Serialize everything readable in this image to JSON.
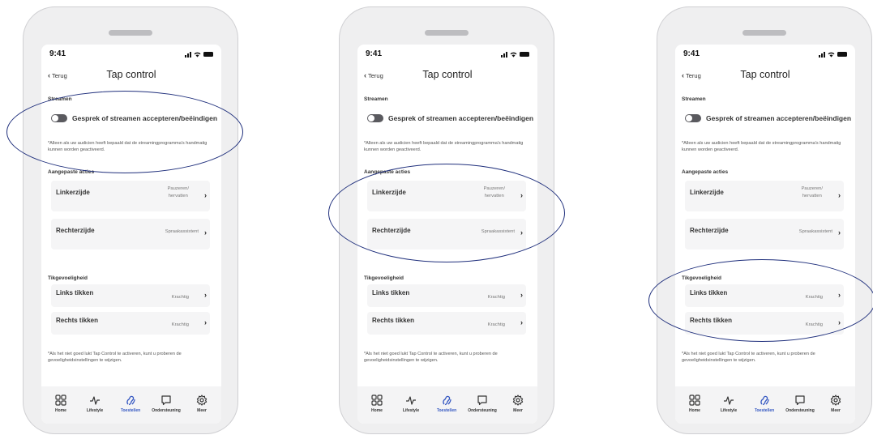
{
  "status": {
    "time": "9:41"
  },
  "nav": {
    "back_label": "Terug",
    "title": "Tap control"
  },
  "streaming": {
    "header": "Streamen",
    "toggle_label": "Gesprek of streamen accepteren/beëindigen",
    "note": "*Alleen als uw audicien heeft bepaald dat de streamingprogramma's handmatig kunnen worden geactiveerd."
  },
  "custom_actions": {
    "header": "Aangepaste acties",
    "left": {
      "label": "Linkerzijde",
      "value_line1": "Pauzeren/",
      "value_line2": "hervatten"
    },
    "right": {
      "label": "Rechterzijde",
      "value": "Spraakassistent"
    }
  },
  "sensitivity": {
    "header": "Tikgevoeligheid",
    "left": {
      "label": "Links tikken",
      "value": "Krachtig"
    },
    "right": {
      "label": "Rechts tikken",
      "value": "Krachtig"
    },
    "note": "*Als het niet goed lukt Tap Control te activeren, kunt u proberen de gevoeligheidsinstellingen te wijzigen."
  },
  "tabs": [
    {
      "label": "Home",
      "icon": "grid-icon"
    },
    {
      "label": "Lifestyle",
      "icon": "pulse-icon"
    },
    {
      "label": "Toestellen",
      "icon": "hearing-aid-icon"
    },
    {
      "label": "Ondersteuning",
      "icon": "chat-icon"
    },
    {
      "label": "Meer",
      "icon": "gear-icon"
    }
  ],
  "colors": {
    "accent": "#3558c2",
    "highlight_oval": "#1f2f7c"
  }
}
